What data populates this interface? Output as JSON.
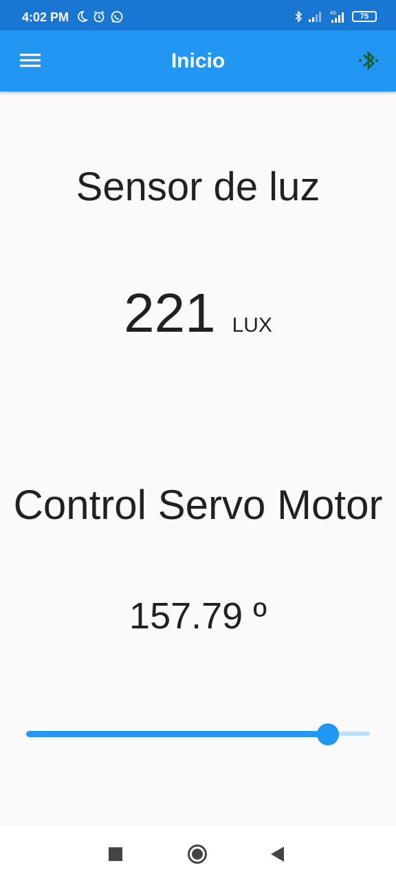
{
  "status_bar": {
    "time": "4:02 PM",
    "left_icons": [
      "moon-icon",
      "alarm-icon",
      "whatsapp-icon"
    ],
    "right_icons": [
      "bluetooth-icon",
      "signal-icon",
      "signal-4g-icon"
    ],
    "battery": "75"
  },
  "app_bar": {
    "title": "Inicio",
    "menu_icon": "hamburger-menu-icon",
    "action_icon": "bluetooth-searching-icon",
    "action_color": "#1b5e20",
    "color": "#2196f3"
  },
  "sensor": {
    "title": "Sensor de luz",
    "value": "221",
    "unit": "LUX"
  },
  "servo": {
    "title": "Control Servo Motor",
    "angle_text": "157.79 º",
    "slider_fraction": 0.877
  },
  "nav_bar": {
    "buttons": [
      "recent-apps-icon",
      "home-icon",
      "back-icon"
    ]
  }
}
